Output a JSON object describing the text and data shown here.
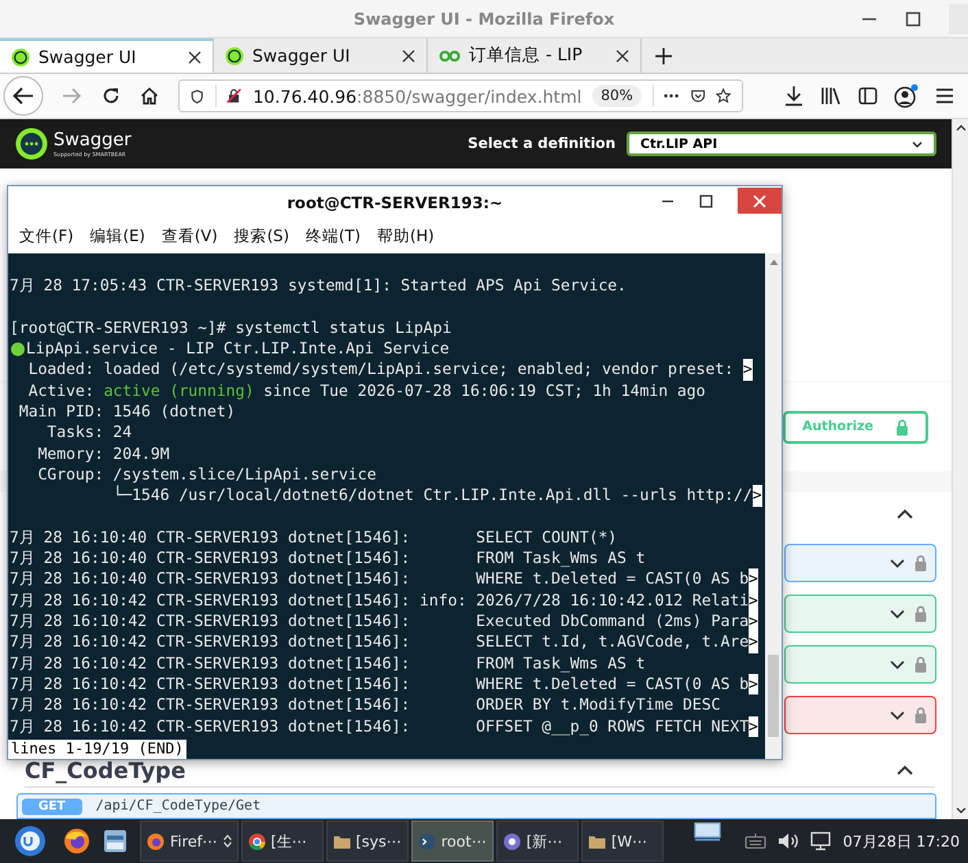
{
  "browser": {
    "title": "Swagger UI - Mozilla Firefox",
    "tabs": [
      {
        "label": "Swagger UI",
        "kind": "swagger",
        "selected": true
      },
      {
        "label": "Swagger UI",
        "kind": "swagger",
        "selected": false
      },
      {
        "label": "订单信息 - LIP",
        "kind": "lip",
        "selected": false
      }
    ],
    "url": {
      "host": "10.76.40.96",
      "rest": ":8850/swagger/index.html"
    },
    "zoom": "80%"
  },
  "swagger": {
    "brand": "Swagger",
    "supported_by": "Supported by SMARTBEAR",
    "definition_label": "Select a definition",
    "definition": "Ctr.LIP API",
    "authorize": "Authorize",
    "operations": [
      {
        "kind": "get"
      },
      {
        "kind": "post"
      },
      {
        "kind": "post"
      },
      {
        "kind": "delete"
      }
    ],
    "section": {
      "title": "CF_CodeType",
      "operation": {
        "kind": "get",
        "method": "GET",
        "path": "/api/CF_CodeType/Get"
      }
    }
  },
  "terminal": {
    "title": "root@CTR-SERVER193:~",
    "menu": [
      "文件(F)",
      "编辑(E)",
      "查看(V)",
      "搜索(S)",
      "终端(T)",
      "帮助(H)"
    ],
    "lines": [
      {
        "kind": "blank"
      },
      {
        "kind": "plain",
        "text": "7月 28 17:05:43 CTR-SERVER193 systemd[1]: Started APS Api Service."
      },
      {
        "kind": "blank"
      },
      {
        "kind": "plain",
        "text": "[root@CTR-SERVER193 ~]# systemctl status LipApi"
      },
      {
        "kind": "status",
        "text": "LipApi.service - LIP Ctr.LIP.Inte.Api Service"
      },
      {
        "kind": "plain",
        "text": "  Loaded: loaded (/etc/systemd/system/LipApi.service; enabled; vendor preset: ",
        "more": ">"
      },
      {
        "kind": "active",
        "text": "  Active: ",
        "state": "active (running)",
        "rest": " since Tue 2026-07-28 16:06:19 CST; 1h 14min ago"
      },
      {
        "kind": "plain",
        "text": " Main PID: 1546 (dotnet)"
      },
      {
        "kind": "plain",
        "text": "    Tasks: 24"
      },
      {
        "kind": "plain",
        "text": "   Memory: 204.9M"
      },
      {
        "kind": "plain",
        "text": "   CGroup: /system.slice/LipApi.service"
      },
      {
        "kind": "plain",
        "text": "           └─1546 /usr/local/dotnet6/dotnet Ctr.LIP.Inte.Api.dll --urls http://",
        "more": ">"
      },
      {
        "kind": "blank"
      },
      {
        "kind": "plain",
        "text": "7月 28 16:10:40 CTR-SERVER193 dotnet[1546]:       SELECT COUNT(*)"
      },
      {
        "kind": "plain",
        "text": "7月 28 16:10:40 CTR-SERVER193 dotnet[1546]:       FROM Task_Wms AS t"
      },
      {
        "kind": "plain",
        "text": "7月 28 16:10:40 CTR-SERVER193 dotnet[1546]:       WHERE t.Deleted = CAST(0 AS b",
        "more": ">"
      },
      {
        "kind": "plain",
        "text": "7月 28 16:10:42 CTR-SERVER193 dotnet[1546]: info: 2026/7/28 16:10:42.012 Relati",
        "more": ">"
      },
      {
        "kind": "plain",
        "text": "7月 28 16:10:42 CTR-SERVER193 dotnet[1546]:       Executed DbCommand (2ms) Para",
        "more": ">"
      },
      {
        "kind": "plain",
        "text": "7月 28 16:10:42 CTR-SERVER193 dotnet[1546]:       SELECT t.Id, t.AGVCode, t.Are",
        "more": ">"
      },
      {
        "kind": "plain",
        "text": "7月 28 16:10:42 CTR-SERVER193 dotnet[1546]:       FROM Task_Wms AS t"
      },
      {
        "kind": "plain",
        "text": "7月 28 16:10:42 CTR-SERVER193 dotnet[1546]:       WHERE t.Deleted = CAST(0 AS b",
        "more": ">"
      },
      {
        "kind": "plain",
        "text": "7月 28 16:10:42 CTR-SERVER193 dotnet[1546]:       ORDER BY t.ModifyTime DESC"
      },
      {
        "kind": "plain",
        "text": "7月 28 16:10:42 CTR-SERVER193 dotnet[1546]:       OFFSET @__p_0 ROWS FETCH NEXT",
        "more": ">"
      }
    ],
    "status": "lines 1-19/19 (END)"
  },
  "taskbar": {
    "tasks": [
      {
        "label": "Firef⋯",
        "kind": "firefox",
        "selected": false
      },
      {
        "label": "[生⋯",
        "kind": "chrome",
        "selected": false
      },
      {
        "label": "[sys⋯",
        "kind": "folder",
        "selected": false
      },
      {
        "label": "root⋯",
        "kind": "terminal",
        "selected": true
      },
      {
        "label": "[新⋯",
        "kind": "app",
        "selected": false
      },
      {
        "label": "[W⋯",
        "kind": "folder",
        "selected": false
      }
    ],
    "clock": "07月28日 17:20"
  }
}
